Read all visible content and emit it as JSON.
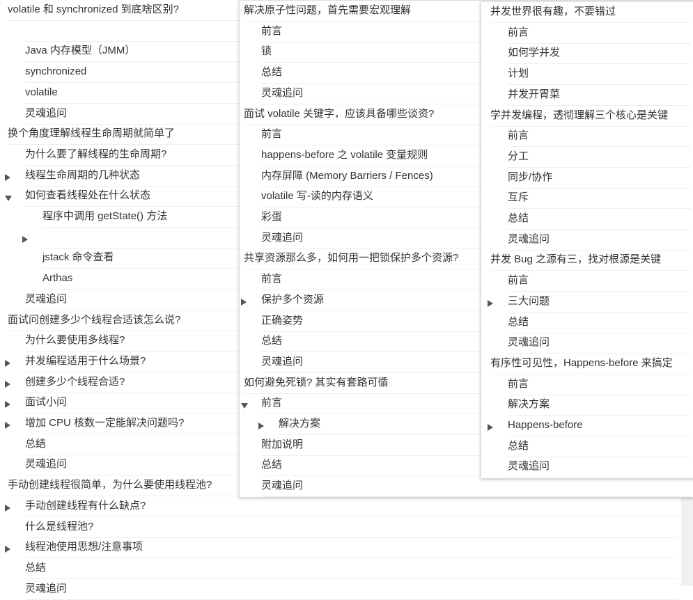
{
  "toc_panels": [
    {
      "id": "panel-a",
      "items": [
        {
          "text": "volatile 和 synchronized 到底啥区别?",
          "level": 0
        },
        {
          "text": "",
          "level": 1
        },
        {
          "text": "Java 内存模型（JMM）",
          "level": 1
        },
        {
          "text": "synchronized",
          "level": 1
        },
        {
          "text": "volatile",
          "level": 1
        },
        {
          "text": "灵魂追问",
          "level": 1
        },
        {
          "text": "换个角度理解线程生命周期就简单了",
          "level": 0
        },
        {
          "text": "为什么要了解线程的生命周期?",
          "level": 1
        },
        {
          "text": "线程生命周期的几种状态",
          "level": 1,
          "toggle": "collapsed"
        },
        {
          "text": "如何查看线程处在什么状态",
          "level": 1,
          "toggle": "expanded"
        },
        {
          "text": "程序中调用 getState() 方法",
          "level": 2
        },
        {
          "text": "",
          "level": 2,
          "toggle": "collapsed"
        },
        {
          "text": "jstack 命令查看",
          "level": 2
        },
        {
          "text": "Arthas",
          "level": 2
        },
        {
          "text": "灵魂追问",
          "level": 1
        },
        {
          "text": "面试问创建多少个线程合适该怎么说?",
          "level": 0
        },
        {
          "text": "为什么要使用多线程?",
          "level": 1
        },
        {
          "text": "并发编程适用于什么场景?",
          "level": 1,
          "toggle": "collapsed"
        },
        {
          "text": "创建多少个线程合适?",
          "level": 1,
          "toggle": "collapsed"
        },
        {
          "text": "面试小问",
          "level": 1,
          "toggle": "collapsed"
        },
        {
          "text": "增加 CPU 核数一定能解决问题吗?",
          "level": 1,
          "toggle": "collapsed"
        },
        {
          "text": "总结",
          "level": 1
        },
        {
          "text": "灵魂追问",
          "level": 1
        },
        {
          "text": "手动创建线程很简单，为什么要使用线程池?",
          "level": 0
        },
        {
          "text": "手动创建线程有什么缺点?",
          "level": 1,
          "toggle": "collapsed"
        },
        {
          "text": "什么是线程池?",
          "level": 1
        },
        {
          "text": "线程池使用思想/注意事项",
          "level": 1,
          "toggle": "collapsed"
        },
        {
          "text": "总结",
          "level": 1
        },
        {
          "text": "灵魂追问",
          "level": 1
        }
      ]
    },
    {
      "id": "panel-b",
      "items": [
        {
          "text": "解决原子性问题，首先需要宏观理解",
          "level": 0
        },
        {
          "text": "前言",
          "level": 1
        },
        {
          "text": "锁",
          "level": 1
        },
        {
          "text": "总结",
          "level": 1
        },
        {
          "text": "灵魂追问",
          "level": 1
        },
        {
          "text": "面试 volatile 关键字，应该具备哪些谈资?",
          "level": 0
        },
        {
          "text": "前言",
          "level": 1
        },
        {
          "text": "happens-before 之 volatile 变量规则",
          "level": 1
        },
        {
          "text": "内存屏障 (Memory Barriers / Fences)",
          "level": 1
        },
        {
          "text": "volatile 写-读的内存语义",
          "level": 1
        },
        {
          "text": "彩蛋",
          "level": 1
        },
        {
          "text": "灵魂追问",
          "level": 1
        },
        {
          "text": "共享资源那么多，如何用一把锁保护多个资源?",
          "level": 0
        },
        {
          "text": "前言",
          "level": 1
        },
        {
          "text": "保护多个资源",
          "level": 1,
          "toggle": "collapsed"
        },
        {
          "text": "正确姿势",
          "level": 1
        },
        {
          "text": "总结",
          "level": 1
        },
        {
          "text": "灵魂追问",
          "level": 1
        },
        {
          "text": "如何避免死锁? 其实有套路可循",
          "level": 0
        },
        {
          "text": "前言",
          "level": 1,
          "toggle": "expanded"
        },
        {
          "text": "解决方案",
          "level": 2,
          "toggle": "collapsed"
        },
        {
          "text": "附加说明",
          "level": 1
        },
        {
          "text": "总结",
          "level": 1
        },
        {
          "text": "灵魂追问",
          "level": 1
        }
      ]
    },
    {
      "id": "panel-c",
      "items": [
        {
          "text": "并发世界很有趣，不要错过",
          "level": 0
        },
        {
          "text": "前言",
          "level": 1
        },
        {
          "text": "如何学并发",
          "level": 1
        },
        {
          "text": "计划",
          "level": 1
        },
        {
          "text": "并发开胃菜",
          "level": 1
        },
        {
          "text": "学并发编程，透彻理解三个核心是关键",
          "level": 0
        },
        {
          "text": "前言",
          "level": 1
        },
        {
          "text": "分工",
          "level": 1
        },
        {
          "text": "同步/协作",
          "level": 1
        },
        {
          "text": "互斥",
          "level": 1
        },
        {
          "text": "总结",
          "level": 1
        },
        {
          "text": "灵魂追问",
          "level": 1
        },
        {
          "text": "并发 Bug 之源有三，找对根源是关键",
          "level": 0
        },
        {
          "text": "前言",
          "level": 1
        },
        {
          "text": "三大问题",
          "level": 1,
          "toggle": "collapsed"
        },
        {
          "text": "总结",
          "level": 1
        },
        {
          "text": "灵魂追问",
          "level": 1
        },
        {
          "text": "有序性可见性，Happens-before 来搞定",
          "level": 0
        },
        {
          "text": "前言",
          "level": 1
        },
        {
          "text": "解决方案",
          "level": 1
        },
        {
          "text": "Happens-before",
          "level": 1,
          "toggle": "collapsed"
        },
        {
          "text": "总结",
          "level": 1
        },
        {
          "text": "灵魂追问",
          "level": 1
        }
      ]
    }
  ],
  "colors": {
    "text": "#333333",
    "caret": "#555555",
    "divider": "#efefef",
    "border": "#dddddd"
  }
}
